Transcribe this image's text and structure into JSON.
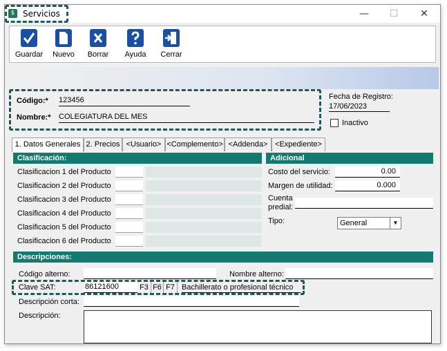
{
  "window": {
    "title": "Servicios",
    "app_icon_glyph": "$",
    "minimize_glyph": "—",
    "maximize_glyph": "☐",
    "close_glyph": "✕"
  },
  "toolbar": {
    "guardar": "Guardar",
    "nuevo": "Nuevo",
    "borrar": "Borrar",
    "ayuda": "Ayuda",
    "cerrar": "Cerrar"
  },
  "header": {
    "codigo_label": "Código:*",
    "codigo_value": "123456",
    "nombre_label": "Nombre:*",
    "nombre_value": "COLEGIATURA DEL MES",
    "fecha_label": "Fecha de Registro:",
    "fecha_value": "17/06/2023",
    "inactivo_label": "Inactivo"
  },
  "tabs": [
    {
      "label": "1. Datos Generales"
    },
    {
      "label": "2. Precios"
    },
    {
      "label": "<Usuario>"
    },
    {
      "label": "<Complemento>"
    },
    {
      "label": "<Addenda>"
    },
    {
      "label": "<Expediente>"
    }
  ],
  "clasificacion": {
    "title": "Clasificación:",
    "items": [
      "Clasificacion 1 del Producto",
      "Clasificacion 2 del Producto",
      "Clasificacion 3 del Producto",
      "Clasificacion 4 del Producto",
      "Clasificacion 5 del Producto",
      "Clasificacion 6 del Producto"
    ]
  },
  "adicional": {
    "title": "Adicional",
    "costo_label": "Costo del servicio:",
    "costo_value": "0.00",
    "margen_label": "Margen de utilidad:",
    "margen_value": "0.000",
    "cuenta_label_1": "Cuenta",
    "cuenta_label_2": "predial:",
    "tipo_label": "Tipo:",
    "tipo_value": "General"
  },
  "descripciones": {
    "title": "Descripciones:",
    "codigo_alterno_label": "Código alterno:",
    "nombre_alterno_label": "Nombre alterno:",
    "clave_sat_label": "Clave SAT:",
    "clave_sat_value": "86121600",
    "f3": "F3",
    "f6": "F6",
    "f7": "F7",
    "clave_sat_desc": "Bachillerato o profesional técnico",
    "desc_corta_label": "Descripción corta:",
    "descripcion_label": "Descripción:"
  },
  "colors": {
    "teal_header": "#127b70",
    "highlight_dash": "#1e5a57",
    "toolbar_icon": "#1a4fa3"
  }
}
